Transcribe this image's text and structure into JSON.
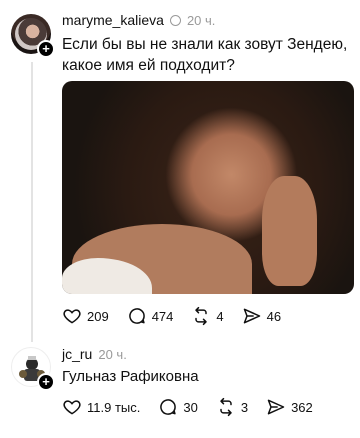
{
  "post": {
    "username": "maryme_kalieva",
    "time": "20 ч.",
    "text_line1": "Если бы вы не знали как зовут Зендею,",
    "text_line2": "какое имя ей подходит?",
    "stats": {
      "likes": "209",
      "replies": "474",
      "reposts": "4",
      "shares": "46"
    }
  },
  "reply": {
    "username": "jc_ru",
    "time": "20 ч.",
    "text": "Гульназ Рафиковна",
    "stats": {
      "likes": "11.9 тыс.",
      "replies": "30",
      "reposts": "3",
      "shares": "362"
    }
  },
  "icons": {
    "like": "heart-icon",
    "reply": "comment-icon",
    "repost": "repost-icon",
    "share": "send-icon",
    "follow": "plus-icon",
    "verified": "verified-icon"
  }
}
